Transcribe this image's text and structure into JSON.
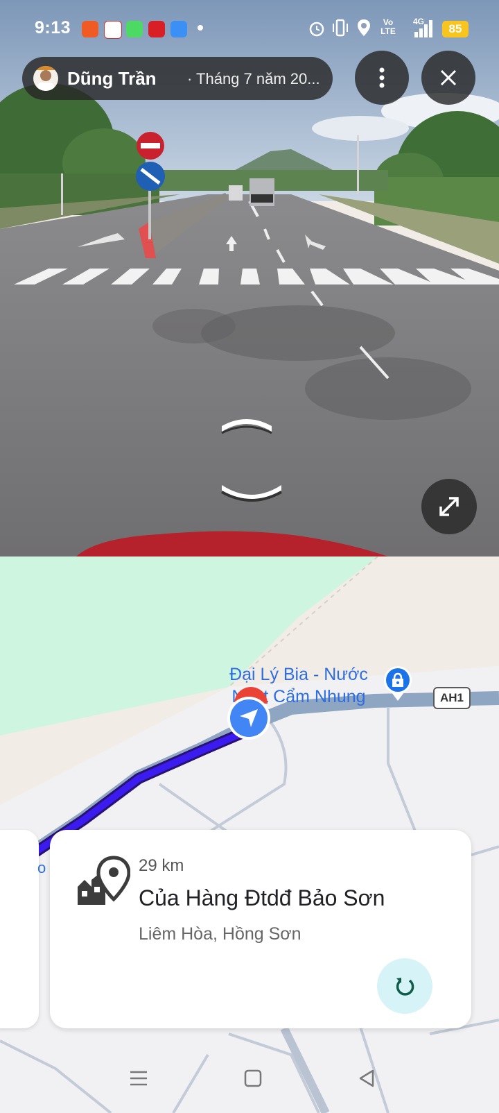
{
  "status_bar": {
    "time": "9:13",
    "battery": "85",
    "network_label": "4G",
    "volte_label": "Vo LTE"
  },
  "header": {
    "contributor_name": "Dũng Trần",
    "capture_date": "· Tháng 7 năm 20..."
  },
  "map": {
    "poi_label_line1": "Đại Lý Bia - Nước",
    "poi_label_line2": "Ngọt Cẩm Nhung",
    "road_shield": "AH1"
  },
  "place_card": {
    "distance": "29 km",
    "title": "Của Hàng Đtdđ Bảo Sơn",
    "address": "Liêm Hòa, Hồng Sơn"
  },
  "colors": {
    "route": "#3b1cf0",
    "location_blue": "#4285f4",
    "pin_red": "#ea4335",
    "park_green": "#cdf5df",
    "battery_yellow": "#f7c51e"
  }
}
